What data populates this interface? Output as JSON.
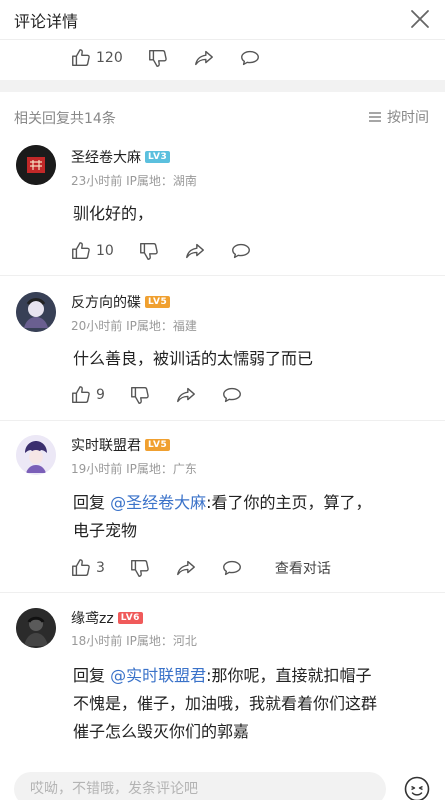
{
  "header": {
    "title": "评论详情"
  },
  "parent_actions": {
    "like_count": "120"
  },
  "section": {
    "label": "相关回复共14条",
    "sort_label": "按时间"
  },
  "comments": [
    {
      "name": "圣经卷大麻",
      "level": "LV3",
      "level_color": "#5bc0de",
      "time": "23小时前",
      "ip": "IP属地：湖南",
      "text": "驯化好的，",
      "like_count": "10"
    },
    {
      "name": "反方向的碟",
      "level": "LV5",
      "level_color": "#f0a030",
      "time": "20小时前",
      "ip": "IP属地：福建",
      "text": "什么善良，被训话的太懦弱了而已",
      "like_count": "9"
    },
    {
      "name": "实时联盟君",
      "level": "LV5",
      "level_color": "#f0a030",
      "time": "19小时前",
      "ip": "IP属地：广东",
      "reply_prefix": "回复 ",
      "mention": "@圣经卷大麻",
      "text": ":看了你的主页，算了，",
      "text2": "电子宠物",
      "like_count": "3",
      "view_dialog": "查看对话"
    },
    {
      "name": "缘鸢zz",
      "level": "LV6",
      "level_color": "#f05a5a",
      "time": "18小时前",
      "ip": "IP属地：河北",
      "reply_prefix": "回复 ",
      "mention": "@实时联盟君",
      "text": ":那你呢，直接就扣帽子",
      "text2": "不愧是，催子，加油哦，我就看着你们这群",
      "text3": "催子怎么毁灭你们的郭嘉"
    }
  ],
  "input": {
    "placeholder": "哎呦，不错哦，发条评论吧"
  },
  "colors": {
    "mention": "#3a72c9",
    "meta": "#999999"
  }
}
